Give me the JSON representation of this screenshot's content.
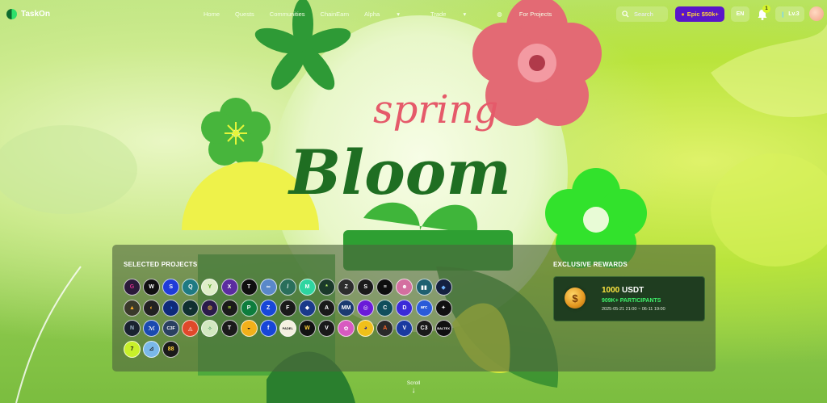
{
  "nav": {
    "logo": "TaskOn",
    "menu": [
      "Home",
      "Quests",
      "Communities",
      "ChainEarn",
      "Alpha",
      "Trade",
      "For Projects"
    ],
    "search_placeholder": "Search",
    "epic_label": "Epic $50k+",
    "language": "EN",
    "notification_count": "1",
    "level": "Lv.3"
  },
  "hero": {
    "title_script": "spring",
    "title_main": "Bloom"
  },
  "selected_projects": {
    "title": "SELECTED PROJECTS",
    "items": [
      {
        "label": "G",
        "bg": "#2b1a3a",
        "fg": "#e02f8f"
      },
      {
        "label": "W",
        "bg": "#111111",
        "fg": "#ffffff"
      },
      {
        "label": "S",
        "bg": "#1f3bd8",
        "fg": "#ffffff"
      },
      {
        "label": "Q",
        "bg": "#1e7a82",
        "fg": "#ffffff"
      },
      {
        "label": "Y",
        "bg": "#dfeec8",
        "fg": "#4fa21b"
      },
      {
        "label": "X",
        "bg": "#5b2ca0",
        "fg": "#ffffff"
      },
      {
        "label": "T",
        "bg": "#0f0f0f",
        "fg": "#ffffff"
      },
      {
        "label": "∞",
        "bg": "#5a88c9",
        "fg": "#ffffff"
      },
      {
        "label": "/",
        "bg": "#2a6f5b",
        "fg": "#ffffff"
      },
      {
        "label": "M",
        "bg": "#2ed5a0",
        "fg": "#ffffff"
      },
      {
        "label": "*",
        "bg": "#1b3a2a",
        "fg": "#c8ff6a"
      },
      {
        "label": "Z",
        "bg": "#2d2d2d",
        "fg": "#ffffff"
      },
      {
        "label": "S",
        "bg": "#1a1a1a",
        "fg": "#ffffff"
      },
      {
        "label": "≡",
        "bg": "#0e0e0e",
        "fg": "#ffffff"
      },
      {
        "label": "☻",
        "bg": "#d46fa0",
        "fg": "#ffffff"
      },
      {
        "label": "▮▮",
        "bg": "#1d6070",
        "fg": "#ffffff"
      },
      {
        "label": "◆",
        "bg": "#142040",
        "fg": "#6fb4ff"
      },
      {
        "label": "▲",
        "bg": "#3a3a2a",
        "fg": "#ffae2a"
      },
      {
        "label": "◐",
        "bg": "#222222",
        "fg": "#ffae2a"
      },
      {
        "label": "◑",
        "bg": "#0e2a7a",
        "fg": "#3f8cff"
      },
      {
        "label": "⌄",
        "bg": "#103030",
        "fg": "#ffffff"
      },
      {
        "label": "◍",
        "bg": "#2a1a4a",
        "fg": "#ffca3a"
      },
      {
        "label": "≡",
        "bg": "#1a1a1a",
        "fg": "#c8ff3a"
      },
      {
        "label": "P",
        "bg": "#0d7d3d",
        "fg": "#ffffff"
      },
      {
        "label": "Z",
        "bg": "#1747d8",
        "fg": "#ffffff"
      },
      {
        "label": "F",
        "bg": "#1a1a1a",
        "fg": "#ffffff"
      },
      {
        "label": "◆",
        "bg": "#1a3a8a",
        "fg": "#ffffff"
      },
      {
        "label": "A",
        "bg": "#1a1a1a",
        "fg": "#ffffff"
      },
      {
        "label": "MM",
        "bg": "#1b3a70",
        "fg": "#ffffff"
      },
      {
        "label": "◎",
        "bg": "#6a1ad8",
        "fg": "#ffffff"
      },
      {
        "label": "C",
        "bg": "#0f4e5c",
        "fg": "#ffffff"
      },
      {
        "label": "D",
        "bg": "#3a2ad8",
        "fg": "#ffffff"
      },
      {
        "label": "arc",
        "bg": "#2a5ad8",
        "fg": "#ffffff"
      },
      {
        "label": "✦",
        "bg": "#111111",
        "fg": "#ffffff"
      },
      {
        "label": "N",
        "bg": "#1a2230",
        "fg": "#9fb4c8"
      },
      {
        "label": "ℳ",
        "bg": "#1a4ab0",
        "fg": "#ffffff"
      },
      {
        "label": "C3F",
        "bg": "#2a4060",
        "fg": "#ffffff"
      },
      {
        "label": "◬",
        "bg": "#e0482a",
        "fg": "#ffffff"
      },
      {
        "label": "✧",
        "bg": "#d2e8c0",
        "fg": "#2a8a4a"
      },
      {
        "label": "T",
        "bg": "#1a1a1a",
        "fg": "#ffffff"
      },
      {
        "label": "◒",
        "bg": "#f2b01a",
        "fg": "#1a1a1a"
      },
      {
        "label": "f",
        "bg": "#1746d8",
        "fg": "#ffffff"
      },
      {
        "label": "PADEL",
        "bg": "#f5f0e0",
        "fg": "#1a1a1a"
      },
      {
        "label": "W",
        "bg": "#121212",
        "fg": "#ffd23a"
      },
      {
        "label": "V",
        "bg": "#1a1a1a",
        "fg": "#ffffff"
      },
      {
        "label": "✿",
        "bg": "#d85ac0",
        "fg": "#ffffff"
      },
      {
        "label": "◕",
        "bg": "#f0c01a",
        "fg": "#2a2a8a"
      },
      {
        "label": "A",
        "bg": "#2a2a2a",
        "fg": "#ff6a2a"
      },
      {
        "label": "V",
        "bg": "#1a3aa0",
        "fg": "#ffffff"
      },
      {
        "label": "C3",
        "bg": "#1a1a1a",
        "fg": "#ffffff"
      },
      {
        "label": "BALTEX",
        "bg": "#101010",
        "fg": "#ffffff"
      },
      {
        "label": "7",
        "bg": "#c8f02a",
        "fg": "#1a1a1a"
      },
      {
        "label": "⊿",
        "bg": "#7ab8e8",
        "fg": "#1a1a1a"
      },
      {
        "label": "88",
        "bg": "#1a1a1a",
        "fg": "#ffd23a"
      }
    ]
  },
  "rewards": {
    "title": "EXCLUSIVE REWARDS",
    "amount": "1000",
    "unit": "USDT",
    "participants": "909K+ PARTICIPANTS",
    "date_range": "2025-05-21 21:00 ~ 06-11 19:00"
  },
  "scroll_label": "Scroll",
  "colors": {
    "epic_bg": "#5a16c9",
    "epic_text": "#ffd23a",
    "reward_green": "#3ff26b",
    "reward_gold": "#ffe640"
  }
}
